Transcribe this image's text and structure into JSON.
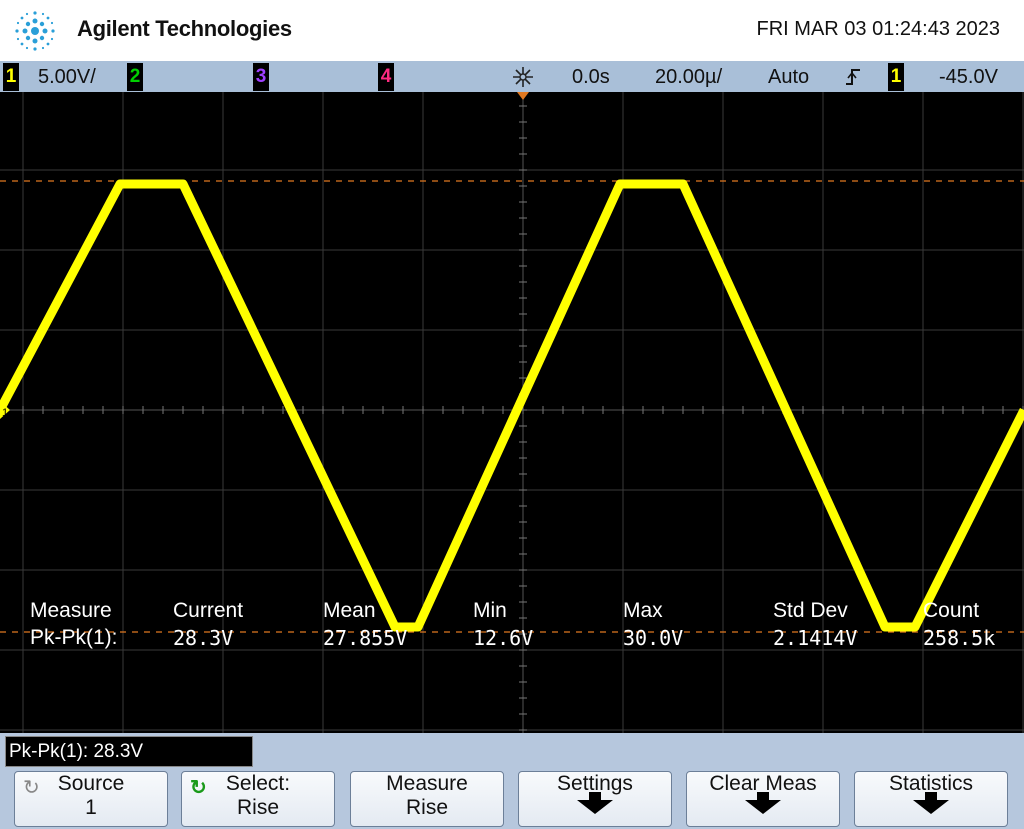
{
  "header": {
    "brand": "Agilent Technologies",
    "datetime": "FRI MAR 03 01:24:43 2023"
  },
  "status_bar": {
    "ch1_label": "1",
    "ch1_scale": "5.00V/",
    "ch2_label": "2",
    "ch3_label": "3",
    "ch4_label": "4",
    "delay": "0.0s",
    "timebase": "20.00µ/",
    "trigger_mode": "Auto",
    "trigger_source": "1",
    "trigger_level": "-45.0V",
    "colors": {
      "ch1": "#ffff00",
      "ch2": "#00d000",
      "ch3": "#a040ff",
      "ch4": "#ff2a80"
    }
  },
  "screen": {
    "ground_marker": "1",
    "measurement_table": {
      "headers": [
        "Measure",
        "Current",
        "Mean",
        "Min",
        "Max",
        "Std Dev",
        "Count"
      ],
      "row": [
        "Pk-Pk(1):",
        "28.3V",
        "27.855V",
        "12.6V",
        "30.0V",
        "2.1414V",
        "258.5k"
      ]
    },
    "trace_color": "#ffff00"
  },
  "readout": {
    "text": "Pk-Pk(1): 28.3V"
  },
  "softkeys": [
    {
      "line1": "Source",
      "line2": "1",
      "icon": "rotate-knob-icon"
    },
    {
      "line1": "Select:",
      "line2": "Rise",
      "icon": "select-knob-icon"
    },
    {
      "line1": "Measure",
      "line2": "Rise"
    },
    {
      "line1": "Settings",
      "icon": "submenu-arrow-icon"
    },
    {
      "line1": "Clear Meas",
      "icon": "submenu-arrow-icon"
    },
    {
      "line1": "Statistics",
      "icon": "submenu-arrow-icon"
    }
  ]
}
